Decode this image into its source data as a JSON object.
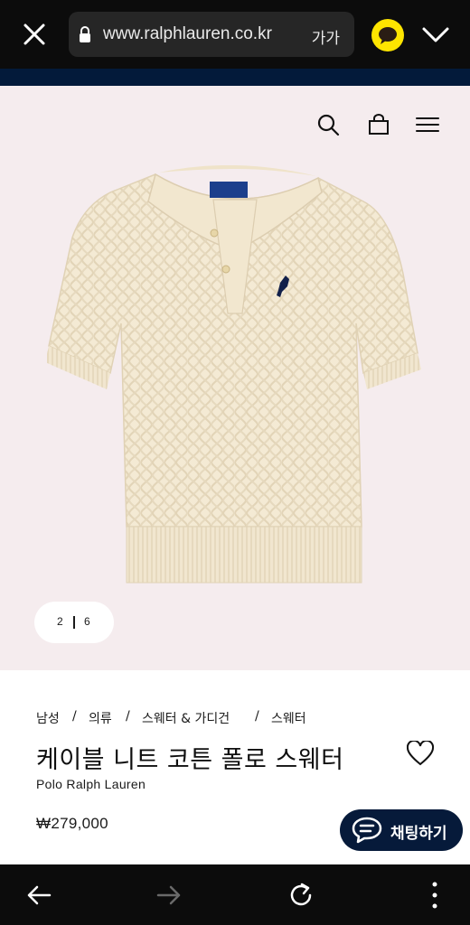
{
  "browser": {
    "url": "www.ralphlauren.co.kr",
    "text_size_label": "가가"
  },
  "header": {
    "icons": [
      "search-icon",
      "shopping-bag-icon",
      "hamburger-menu-icon"
    ]
  },
  "gallery": {
    "current": "2",
    "total": "6"
  },
  "breadcrumb": {
    "items": [
      "남성",
      "의류",
      "스웨터 & 가디건",
      "스웨터"
    ],
    "separator": "/"
  },
  "product": {
    "title": "케이블 니트 코튼 폴로 스웨터",
    "brand": "Polo Ralph Lauren",
    "price": "₩279,000"
  },
  "chat": {
    "label": "채팅하기"
  },
  "colors": {
    "navy": "#061a3a",
    "product_bg": "#f5ecee",
    "sweater": "#f4ead4",
    "kakao": "#fee500"
  }
}
